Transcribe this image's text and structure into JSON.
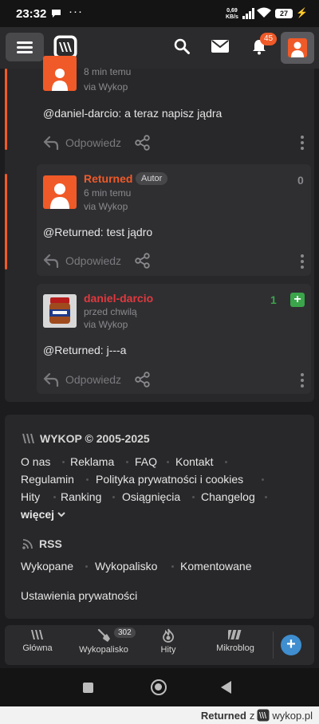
{
  "status_bar": {
    "time": "23:32",
    "net_speed_value": "0,69",
    "net_speed_unit": "KB/s",
    "battery": "27"
  },
  "top_nav": {
    "notifications_count": "45"
  },
  "comments": [
    {
      "time": "8 min temu",
      "via": "via Wykop",
      "body": "@daniel-darcio: a teraz napisz jądra",
      "reply_label": "Odpowiedz"
    },
    {
      "author": "Returned",
      "author_badge": "Autor",
      "time": "6 min temu",
      "via": "via Wykop",
      "votes": "0",
      "body": "@Returned: test jądro",
      "reply_label": "Odpowiedz"
    },
    {
      "author": "daniel-darcio",
      "time": "przed chwilą",
      "via": "via Wykop",
      "votes": "1",
      "plus": "+",
      "body": "@Returned: j---a",
      "reply_label": "Odpowiedz"
    }
  ],
  "footer": {
    "brand": "WYKOP © 2005-2025",
    "links_row1": [
      "O nas",
      "Reklama",
      "FAQ",
      "Kontakt"
    ],
    "links_row2": [
      "Regulamin",
      "Polityka prywatności i cookies"
    ],
    "links_row3": [
      "Hity",
      "Ranking",
      "Osiągnięcia",
      "Changelog"
    ],
    "more": "więcej",
    "rss_title": "RSS",
    "rss_links": [
      "Wykopane",
      "Wykopalisko",
      "Komentowane"
    ],
    "privacy_settings": "Ustawienia prywatności"
  },
  "bottom_nav": {
    "items": [
      "Główna",
      "Wykopalisko",
      "Hity",
      "Mikroblog"
    ],
    "wykopalisko_count": "302",
    "fab": "+"
  },
  "watermark": {
    "user": "Returned",
    "z": "z",
    "site": "wykop.pl"
  },
  "colors": {
    "accent": "#f05a28",
    "author_red": "#e0393e",
    "vote_green": "#3aa54a"
  }
}
